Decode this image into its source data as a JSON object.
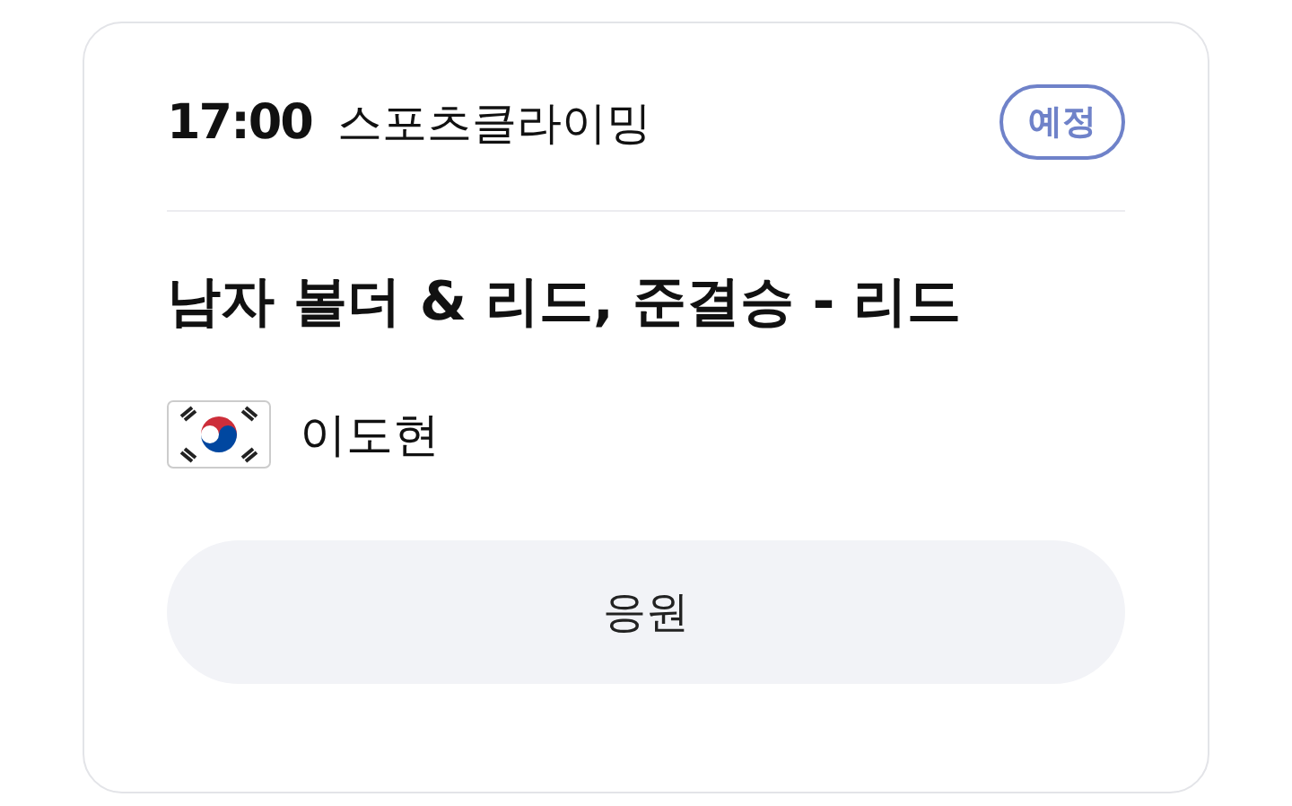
{
  "time": "17:00",
  "sport": "스포츠클라이밍",
  "status": {
    "label": "예정",
    "kind": "scheduled"
  },
  "event": "남자 볼더 & 리드, 준결승 - 리드",
  "athlete": {
    "name": "이도현"
  },
  "button": "응원"
}
